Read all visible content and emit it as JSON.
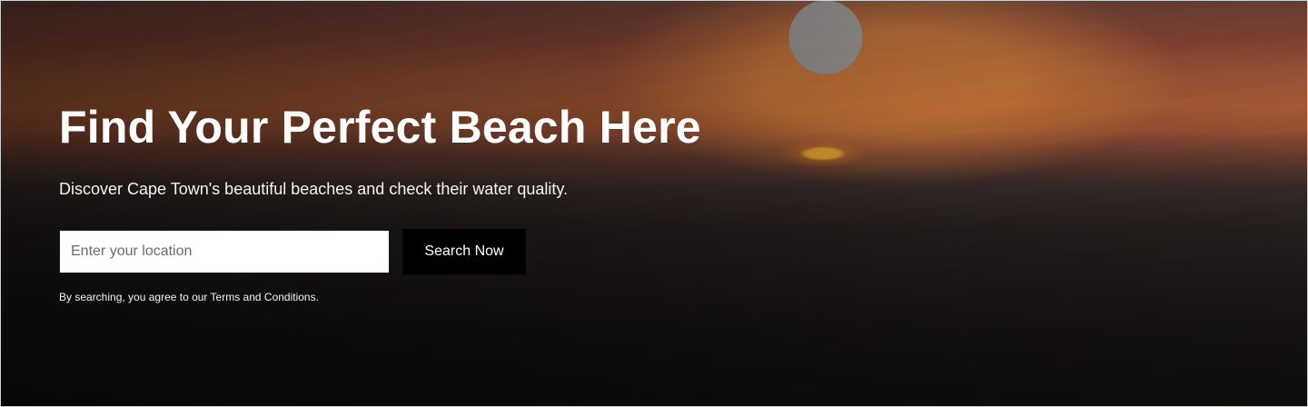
{
  "hero": {
    "title": "Find Your Perfect Beach Here",
    "subtitle": "Discover Cape Town's beautiful beaches and check their water quality.",
    "search": {
      "placeholder": "Enter your location",
      "value": "",
      "button_label": "Search Now"
    },
    "terms_text": "By searching, you agree to our Terms and Conditions."
  },
  "colors": {
    "button_bg": "#000000",
    "button_text": "#ffffff",
    "input_bg": "#ffffff"
  }
}
